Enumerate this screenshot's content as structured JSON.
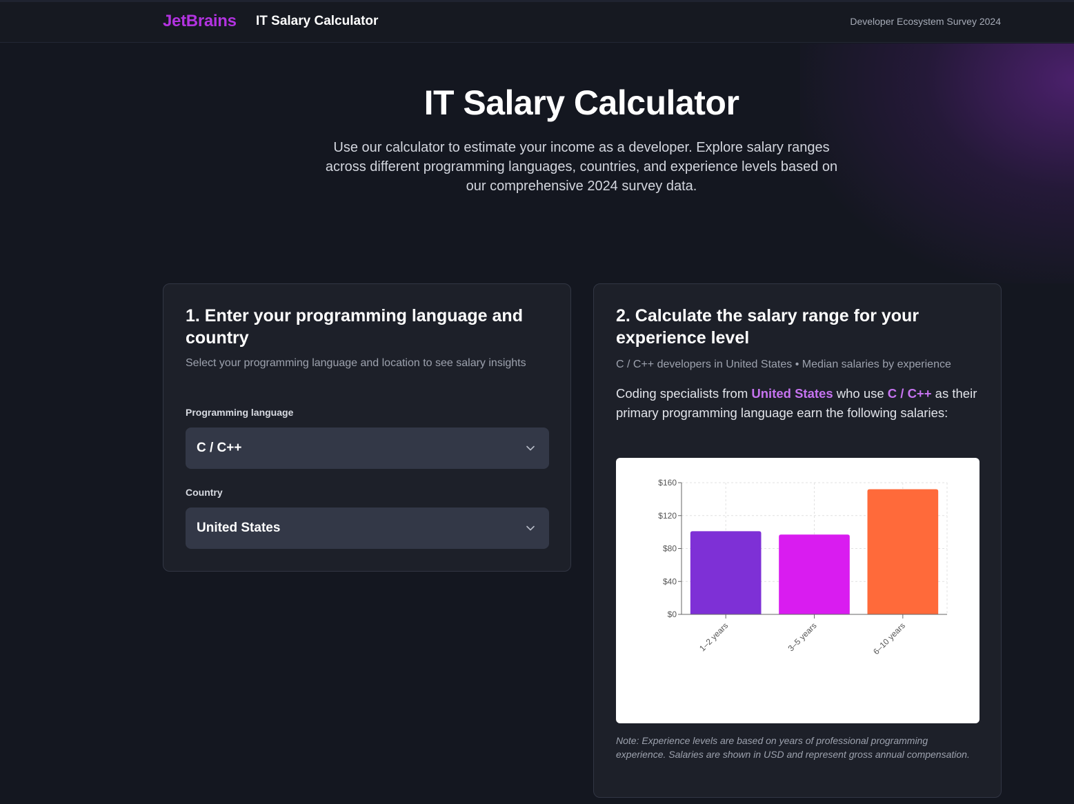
{
  "header": {
    "brand": "JetBrains",
    "app_title": "IT Salary Calculator",
    "survey_label": "Developer Ecosystem Survey 2024"
  },
  "hero": {
    "title": "IT Salary Calculator",
    "subtitle": "Use our calculator to estimate your income as a developer. Explore salary ranges across different programming languages, countries, and experience levels based on our comprehensive 2024 survey data."
  },
  "step1": {
    "title": "1. Enter your programming language and country",
    "subtitle": "Select your programming language and location to see salary insights",
    "language_label": "Programming language",
    "language_value": "C / C++",
    "country_label": "Country",
    "country_value": "United States"
  },
  "step2": {
    "title": "2. Calculate the salary range for your experience level",
    "subtitle": "C / C++ developers in United States • Median salaries by experience",
    "desc_prefix": "Coding specialists from ",
    "desc_country": "United States",
    "desc_middle": " who use ",
    "desc_language": "C / C++",
    "desc_suffix": " as their primary programming language earn the following salaries:",
    "note": "Note: Experience levels are based on years of professional programming experience. Salaries are shown in USD and represent gross annual compensation."
  },
  "colors": {
    "brand": "#b233e0",
    "highlight": "#c673f0"
  },
  "icons": {
    "dropdown": "chevron-down-icon"
  },
  "chart_data": {
    "type": "bar",
    "categories": [
      "1–2 years",
      "3–5 years",
      "6–10 years"
    ],
    "values": [
      101,
      97,
      152
    ],
    "colors": [
      "#7e30d6",
      "#d91cf0",
      "#ff6a3a"
    ],
    "ylim": [
      0,
      160
    ],
    "yticks": [
      0,
      40,
      80,
      120,
      160
    ],
    "ytick_labels": [
      "$0",
      "$40",
      "$80",
      "$120",
      "$160"
    ],
    "grid": true,
    "title": "",
    "xlabel": "",
    "ylabel": ""
  }
}
